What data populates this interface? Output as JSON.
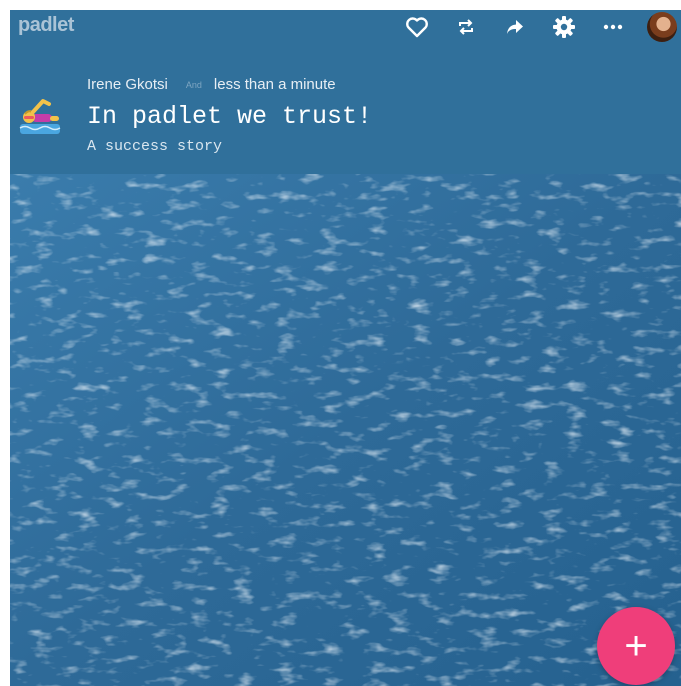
{
  "app": {
    "logo": "padlet"
  },
  "toolbar": {
    "like_icon": "heart-icon",
    "remake_icon": "repeat-icon",
    "share_icon": "share-arrow-icon",
    "settings_icon": "gear-icon",
    "more_icon": "more-dots-icon"
  },
  "header": {
    "author": "Irene Gkotsi",
    "separator": "And",
    "timestamp": "less than a minute",
    "emoji": "swimmer-emoji",
    "title": "In padlet we trust!",
    "subtitle": "A success story"
  },
  "fab": {
    "label": "+"
  },
  "colors": {
    "header_bg": "#30709b",
    "wall_bg": "#2f6a97",
    "fab_bg": "#ef3e7a"
  }
}
